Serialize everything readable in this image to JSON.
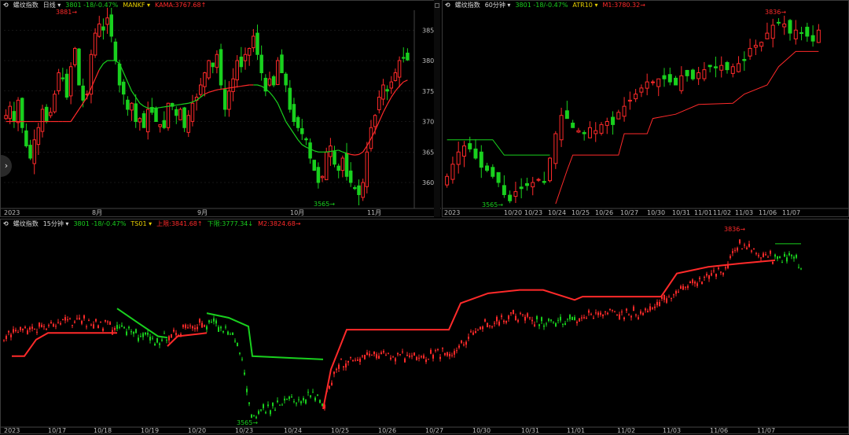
{
  "colors": {
    "up": "#ff2a2a",
    "down": "#19d01e",
    "bg": "#000000",
    "grid": "#2c2c2c",
    "text": "#bdbdbd",
    "yellow": "#e8d000"
  },
  "icons": {
    "panel_menu": "cycle-icon",
    "split_handle": "square-icon",
    "expand": "chevron-right-icon"
  },
  "panels": [
    {
      "name": "螺纹指数",
      "period": "日线 ▾",
      "quote": "3801 -18/-0.47%",
      "indicator": "MANKF ▾",
      "indicator_value": "KAMA:3767.68↑",
      "y_ticks": [
        "3850",
        "3800",
        "3750",
        "3700",
        "3650",
        "3600"
      ],
      "x_labels": [
        "2023",
        "8月",
        "9月",
        "10月",
        "11月"
      ],
      "annotations": {
        "high": "3881",
        "low": "3565"
      }
    },
    {
      "name": "螺纹指数",
      "period": "60分钟 ▾",
      "quote": "3801 -18/-0.47%",
      "indicator": "ATR10 ▾",
      "indicator_value": "M1:3780.32→",
      "x_labels": [
        "2023",
        "10/20",
        "10/23",
        "10/24",
        "10/25",
        "10/26",
        "10/27",
        "10/30",
        "10/31",
        "11/01",
        "11/02",
        "11/03",
        "11/06",
        "11/07"
      ],
      "annotations": {
        "high": "3836",
        "low": "3565"
      }
    },
    {
      "name": "螺纹指数",
      "period": "15分钟 ▾",
      "quote": "3801 -18/-0.47%",
      "indicator": "TS01 ▾",
      "upper": "上限:3841.68↑",
      "lower": "下限:3777.34↓",
      "m2": "M2:3824.68→",
      "x_labels": [
        "2023",
        "10/17",
        "10/18",
        "10/19",
        "10/20",
        "10/23",
        "10/24",
        "10/25",
        "10/26",
        "10/27",
        "10/30",
        "10/31",
        "11/01",
        "11/02",
        "11/03",
        "11/06",
        "11/07"
      ],
      "annotations": {
        "high": "3836",
        "low": "3565"
      }
    }
  ],
  "chart_data": [
    {
      "type": "candlestick",
      "title": "螺纹指数 日线",
      "ylim": [
        3560,
        3880
      ],
      "y_ticks": [
        3600,
        3650,
        3700,
        3750,
        3800,
        3850
      ],
      "x_labels": [
        "2023",
        "8月",
        "9月",
        "10月",
        "11月"
      ],
      "close": [
        3710,
        3725,
        3700,
        3735,
        3690,
        3660,
        3640,
        3670,
        3690,
        3720,
        3700,
        3715,
        3745,
        3780,
        3770,
        3740,
        3790,
        3820,
        3760,
        3735,
        3745,
        3810,
        3845,
        3860,
        3850,
        3870,
        3840,
        3800,
        3760,
        3745,
        3720,
        3730,
        3700,
        3705,
        3690,
        3720,
        3715,
        3700,
        3695,
        3690,
        3730,
        3725,
        3710,
        3720,
        3690,
        3710,
        3730,
        3740,
        3760,
        3780,
        3800,
        3790,
        3810,
        3760,
        3720,
        3750,
        3770,
        3800,
        3790,
        3810,
        3820,
        3840,
        3810,
        3780,
        3750,
        3770,
        3760,
        3800,
        3780,
        3760,
        3720,
        3700,
        3690,
        3680,
        3670,
        3640,
        3620,
        3600,
        3610,
        3650,
        3660,
        3630,
        3620,
        3640,
        3610,
        3600,
        3590,
        3580,
        3600,
        3650,
        3690,
        3710,
        3740,
        3760,
        3750,
        3765,
        3780,
        3800,
        3805,
        3801
      ],
      "ma": [
        3700,
        3700,
        3700,
        3700,
        3700,
        3700,
        3700,
        3700,
        3700,
        3700,
        3700,
        3700,
        3700,
        3700,
        3700,
        3700,
        3700,
        3710,
        3720,
        3730,
        3740,
        3755,
        3770,
        3785,
        3795,
        3800,
        3800,
        3800,
        3795,
        3780,
        3765,
        3750,
        3740,
        3730,
        3725,
        3722,
        3722,
        3722,
        3723,
        3724,
        3725,
        3726,
        3727,
        3728,
        3729,
        3730,
        3732,
        3735,
        3740,
        3745,
        3748,
        3750,
        3752,
        3753,
        3754,
        3755,
        3756,
        3757,
        3758,
        3759,
        3760,
        3760,
        3760,
        3758,
        3754,
        3748,
        3740,
        3730,
        3715,
        3700,
        3690,
        3680,
        3670,
        3662,
        3658,
        3655,
        3652,
        3650,
        3650,
        3650,
        3651,
        3652,
        3653,
        3650,
        3648,
        3646,
        3645,
        3646,
        3650,
        3660,
        3672,
        3685,
        3700,
        3715,
        3728,
        3740,
        3750,
        3758,
        3765,
        3768
      ]
    },
    {
      "type": "candlestick",
      "title": "螺纹指数 60分钟",
      "ylim": [
        3560,
        3880
      ],
      "y_ticks": [
        3600,
        3650,
        3700,
        3750,
        3800,
        3850
      ],
      "x_labels": [
        "2023",
        "10/20",
        "10/23",
        "10/24",
        "10/25",
        "10/26",
        "10/27",
        "10/30",
        "10/31",
        "11/01",
        "11/02",
        "11/03",
        "11/06",
        "11/07"
      ],
      "close": [
        3610,
        3630,
        3650,
        3660,
        3655,
        3640,
        3625,
        3620,
        3610,
        3600,
        3580,
        3570,
        3585,
        3590,
        3595,
        3600,
        3605,
        3600,
        3640,
        3680,
        3710,
        3705,
        3690,
        3685,
        3680,
        3690,
        3685,
        3695,
        3700,
        3695,
        3715,
        3725,
        3735,
        3745,
        3755,
        3765,
        3765,
        3770,
        3770,
        3765,
        3760,
        3775,
        3775,
        3770,
        3780,
        3785,
        3790,
        3788,
        3792,
        3785,
        3790,
        3795,
        3800,
        3820,
        3825,
        3830,
        3845,
        3858,
        3862,
        3860,
        3845,
        3850,
        3845,
        3840,
        3832,
        3850
      ],
      "stop": [
        3670,
        3670,
        3670,
        3670,
        3670,
        3670,
        3670,
        3650,
        3650,
        3650,
        3650,
        3650,
        3650,
        3650,
        3650,
        3650,
        3650,
        3650,
        3650,
        3580,
        3600,
        3640,
        3650,
        3650,
        3650,
        3650,
        3650,
        3650,
        3650,
        3650,
        3650,
        3650,
        3650,
        3650,
        3650,
        3650,
        3650,
        3650,
        3650,
        3650,
        3650,
        3650,
        3650,
        3650,
        3650,
        3650,
        3650,
        3650,
        3650,
        3650,
        3650,
        3650,
        3650,
        3650,
        3650,
        3650,
        3650,
        3650,
        3650,
        3650,
        3650,
        3650,
        3650,
        3650,
        3650,
        3650
      ]
    },
    {
      "type": "candlestick",
      "title": "螺纹指数 15分钟",
      "ylim": [
        3555,
        3850
      ],
      "x_labels": [
        "2023",
        "10/17",
        "10/18",
        "10/19",
        "10/20",
        "10/23",
        "10/24",
        "10/25",
        "10/26",
        "10/27",
        "10/30",
        "10/31",
        "11/01",
        "11/02",
        "11/03",
        "11/06",
        "11/07"
      ]
    }
  ]
}
